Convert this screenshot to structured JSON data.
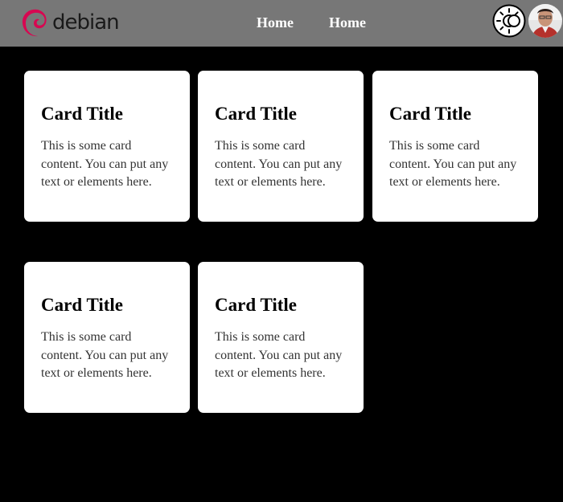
{
  "header": {
    "logo_text": "debian",
    "nav": [
      {
        "label": "Home"
      },
      {
        "label": "Home"
      }
    ],
    "theme_toggle_icon": "sun-moon-icon",
    "avatar_icon": "user-avatar"
  },
  "cards": [
    {
      "title": "Card Title",
      "content": "This is some card content. You can put any text or elements here."
    },
    {
      "title": "Card Title",
      "content": "This is some card content. You can put any text or elements here."
    },
    {
      "title": "Card Title",
      "content": "This is some card content. You can put any text or elements here."
    },
    {
      "title": "Card Title",
      "content": "This is some card content. You can put any text or elements here."
    },
    {
      "title": "Card Title",
      "content": "This is some card content. You can put any text or elements here."
    }
  ],
  "colors": {
    "navbar_bg": "#777777",
    "page_bg": "#000000",
    "card_bg": "#ffffff",
    "brand_red": "#d70751"
  }
}
